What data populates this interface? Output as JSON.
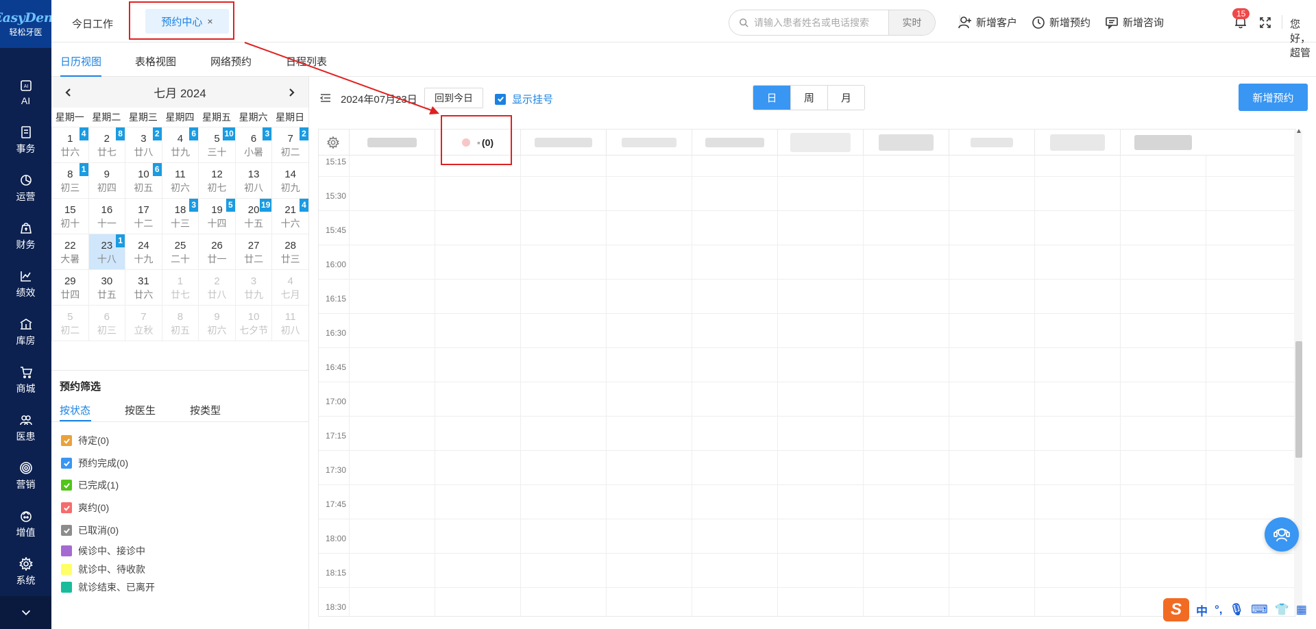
{
  "app": {
    "logo_text": "EasyDent",
    "logo_sub": "轻松牙医"
  },
  "sidebar": {
    "items": [
      {
        "label": "AI",
        "icon": "ai-icon"
      },
      {
        "label": "事务",
        "icon": "task-icon"
      },
      {
        "label": "运营",
        "icon": "pie-chart-icon"
      },
      {
        "label": "财务",
        "icon": "finance-icon"
      },
      {
        "label": "绩效",
        "icon": "line-chart-icon"
      },
      {
        "label": "库房",
        "icon": "warehouse-icon"
      },
      {
        "label": "商城",
        "icon": "cart-icon"
      },
      {
        "label": "医患",
        "icon": "people-icon"
      },
      {
        "label": "营销",
        "icon": "target-icon"
      },
      {
        "label": "增值",
        "icon": "value-icon"
      },
      {
        "label": "系统",
        "icon": "gear-icon"
      }
    ]
  },
  "topbar": {
    "tab_today": "今日工作",
    "tab_active": "预约中心",
    "tab_close": "×",
    "search_placeholder": "请输入患者姓名或电话搜索",
    "search_mode": "实时",
    "add_customer": "新增客户",
    "add_appointment": "新增预约",
    "add_consult": "新增咨询",
    "notification_count": "15",
    "greeting": "您好，超管"
  },
  "subtabs": [
    "日历视图",
    "表格视图",
    "网络预约",
    "日程列表"
  ],
  "mini_calendar": {
    "title": "七月 2024",
    "weekdays": [
      "星期一",
      "星期二",
      "星期三",
      "星期四",
      "星期五",
      "星期六",
      "星期日"
    ],
    "cells": [
      {
        "d": "1",
        "l": "廿六",
        "c": "4"
      },
      {
        "d": "2",
        "l": "廿七",
        "c": "8"
      },
      {
        "d": "3",
        "l": "廿八",
        "c": "2"
      },
      {
        "d": "4",
        "l": "廿九",
        "c": "6"
      },
      {
        "d": "5",
        "l": "三十",
        "c": "10"
      },
      {
        "d": "6",
        "l": "小暑",
        "c": "3"
      },
      {
        "d": "7",
        "l": "初二",
        "c": "2"
      },
      {
        "d": "8",
        "l": "初三",
        "c": "1"
      },
      {
        "d": "9",
        "l": "初四"
      },
      {
        "d": "10",
        "l": "初五",
        "c": "6"
      },
      {
        "d": "11",
        "l": "初六"
      },
      {
        "d": "12",
        "l": "初七"
      },
      {
        "d": "13",
        "l": "初八"
      },
      {
        "d": "14",
        "l": "初九"
      },
      {
        "d": "15",
        "l": "初十"
      },
      {
        "d": "16",
        "l": "十一"
      },
      {
        "d": "17",
        "l": "十二"
      },
      {
        "d": "18",
        "l": "十三",
        "c": "3"
      },
      {
        "d": "19",
        "l": "十四",
        "c": "5"
      },
      {
        "d": "20",
        "l": "十五",
        "c": "19"
      },
      {
        "d": "21",
        "l": "十六",
        "c": "4"
      },
      {
        "d": "22",
        "l": "大暑"
      },
      {
        "d": "23",
        "l": "十八",
        "c": "1",
        "today": true
      },
      {
        "d": "24",
        "l": "十九"
      },
      {
        "d": "25",
        "l": "二十"
      },
      {
        "d": "26",
        "l": "廿一"
      },
      {
        "d": "27",
        "l": "廿二"
      },
      {
        "d": "28",
        "l": "廿三"
      },
      {
        "d": "29",
        "l": "廿四"
      },
      {
        "d": "30",
        "l": "廿五"
      },
      {
        "d": "31",
        "l": "廿六"
      },
      {
        "d": "1",
        "l": "廿七",
        "o": true
      },
      {
        "d": "2",
        "l": "廿八",
        "o": true
      },
      {
        "d": "3",
        "l": "廿九",
        "o": true
      },
      {
        "d": "4",
        "l": "七月",
        "o": true
      },
      {
        "d": "5",
        "l": "初二",
        "o": true
      },
      {
        "d": "6",
        "l": "初三",
        "o": true
      },
      {
        "d": "7",
        "l": "立秋",
        "o": true
      },
      {
        "d": "8",
        "l": "初五",
        "o": true
      },
      {
        "d": "9",
        "l": "初六",
        "o": true
      },
      {
        "d": "10",
        "l": "七夕节",
        "o": true
      },
      {
        "d": "11",
        "l": "初八",
        "o": true
      }
    ]
  },
  "filter": {
    "title": "预约筛选",
    "tabs": [
      "按状态",
      "按医生",
      "按类型"
    ],
    "statuses": [
      {
        "label": "待定(0)",
        "color": "#e9a23b",
        "checked": true
      },
      {
        "label": "预约完成(0)",
        "color": "#3996f2",
        "checked": true
      },
      {
        "label": "已完成(1)",
        "color": "#52c41a",
        "checked": true
      },
      {
        "label": "爽约(0)",
        "color": "#f56c6c",
        "checked": true
      },
      {
        "label": "已取消(0)",
        "color": "#8c8c8c",
        "checked": true
      },
      {
        "label": "候诊中、接诊中",
        "color": "#a46ad2",
        "checked": false
      },
      {
        "label": "就诊中、待收款",
        "color": "#ffff66",
        "checked": false
      },
      {
        "label": "就诊结束、已离开",
        "color": "#1abc9c",
        "checked": false
      }
    ]
  },
  "main": {
    "date_label": "2024年07月23日",
    "today_btn": "回到今日",
    "show_reg": "显示挂号",
    "views": [
      "日",
      "周",
      "月"
    ],
    "new_btn": "新增预约",
    "doctor_col": "(0)",
    "times": [
      "15:15",
      "15:30",
      "15:45",
      "16:00",
      "16:15",
      "16:30",
      "16:45",
      "17:00",
      "17:15",
      "17:30",
      "17:45",
      "18:00",
      "18:15",
      "18:30"
    ]
  },
  "ime": {
    "logo": "S",
    "mode": "中",
    "punct": "°,"
  },
  "colors": {
    "accent": "#1a82e2",
    "sidebar": "#0c2150",
    "annotation": "#e02020"
  }
}
